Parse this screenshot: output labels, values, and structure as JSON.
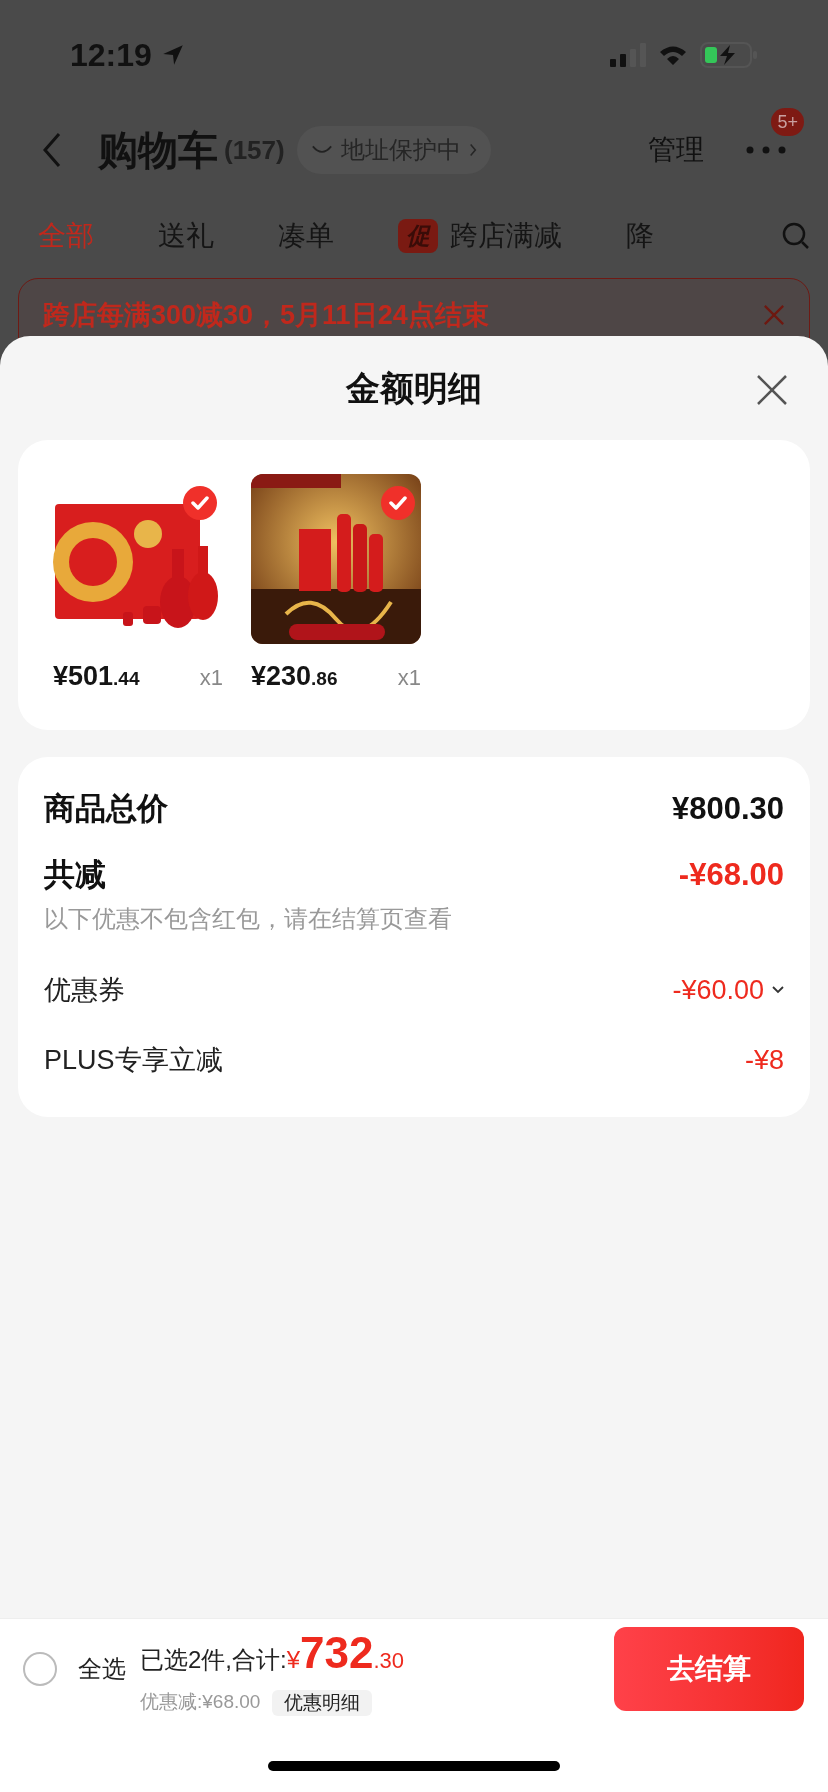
{
  "status_bar": {
    "time": "12:19"
  },
  "nav": {
    "title": "购物车",
    "count": "(157)",
    "address_pill": "地址保护中",
    "manage": "管理",
    "badge": "5+"
  },
  "tabs": [
    {
      "label": "全部",
      "selected": true
    },
    {
      "label": "送礼",
      "selected": false
    },
    {
      "label": "凑单",
      "selected": false
    },
    {
      "label": "跨店满减",
      "badge": "促",
      "selected": false
    },
    {
      "label": "降",
      "selected": false
    }
  ],
  "promo_banner": {
    "text": "跨店每满300减30，5月11日24点结束"
  },
  "sheet": {
    "title": "金额明细",
    "products": [
      {
        "price_main": "¥501",
        "price_cents": ".44",
        "quantity": "x1",
        "selected": true
      },
      {
        "price_main": "¥230",
        "price_cents": ".86",
        "quantity": "x1",
        "selected": true
      }
    ],
    "summary": [
      {
        "kind": "total",
        "label": "商品总价",
        "value": "¥800.30"
      },
      {
        "kind": "discount_total",
        "label": "共减",
        "value": "-¥68.00",
        "note": "以下优惠不包含红包，请在结算页查看"
      },
      {
        "kind": "discount",
        "label": "优惠券",
        "value": "-¥60.00",
        "expandable": true
      },
      {
        "kind": "discount",
        "label": "PLUS专享立减",
        "value": "-¥8",
        "expandable": false
      }
    ]
  },
  "checkout_bar": {
    "select_all": {
      "label": "全选",
      "checked": false
    },
    "selected_text": "已选2件,合计:",
    "currency": "¥",
    "total_main": "732",
    "total_cents": ".30",
    "saving": "优惠减:¥68.00",
    "detail_button": "优惠明细",
    "checkout_button": "去结算"
  }
}
